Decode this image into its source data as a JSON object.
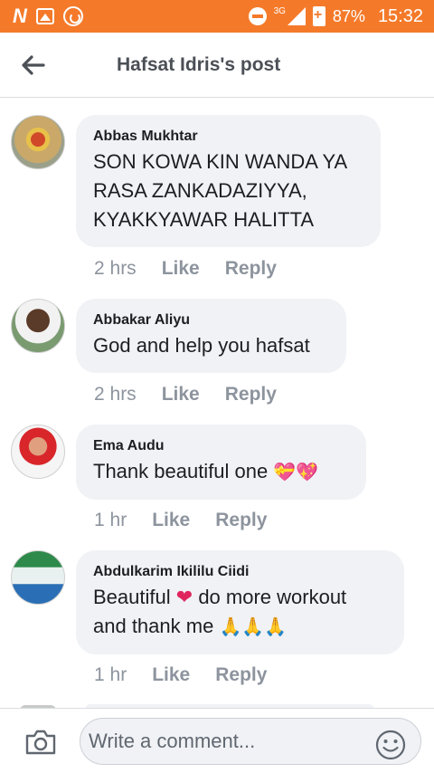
{
  "status_bar": {
    "network": "3G",
    "battery": "87%",
    "time": "15:32"
  },
  "header": {
    "back_icon": "arrow-left-icon",
    "title": "Hafsat Idris's post"
  },
  "comments": [
    {
      "author": "Abbas Mukhtar",
      "lines": [
        "SON KOWA KIN WANDA YA",
        "RASA ZANKADAZIYYA,",
        "KYAKKYAWAR HALITTA"
      ],
      "time": "2 hrs",
      "like": "Like",
      "reply": "Reply"
    },
    {
      "author": "Abbakar Aliyu",
      "lines": [
        "God and help you hafsat"
      ],
      "time": "2 hrs",
      "like": "Like",
      "reply": "Reply"
    },
    {
      "author": "Ema Audu",
      "text": "Thank beautiful one",
      "emojis": "💝💖",
      "time": "1 hr",
      "like": "Like",
      "reply": "Reply"
    },
    {
      "author": "Abdulkarim Ikililu Ciidi",
      "line1_a": "Beautiful",
      "line1_heart": "❤",
      "line1_b": "do more workout",
      "line2": "and thank me",
      "line2_emojis": "🙏🙏🙏",
      "time": "1 hr",
      "like": "Like",
      "reply": "Reply"
    }
  ],
  "footer": {
    "camera_icon": "camera-icon",
    "input_placeholder": "Write a comment...",
    "emoji_icon": "smiley-icon"
  },
  "colors": {
    "status_bar": "#f47a2a",
    "bubble": "#f0f2f5",
    "meta_text": "#8d949e",
    "header_text": "#4b4f56"
  }
}
